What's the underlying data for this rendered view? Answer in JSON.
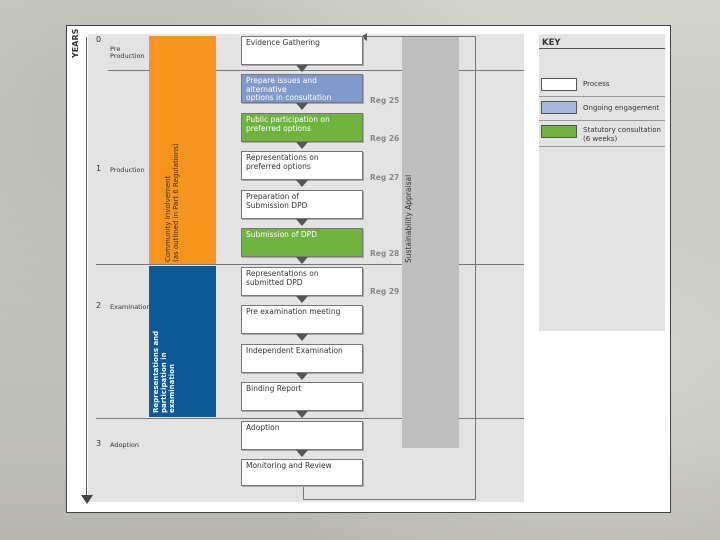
{
  "years_label": "YEARS",
  "stages": [
    {
      "number": "0",
      "label": "Pre Production",
      "label_l1": "Pre",
      "label_l2": "Production"
    },
    {
      "number": "1",
      "label": "Production"
    },
    {
      "number": "2",
      "label": "Examination"
    },
    {
      "number": "3",
      "label": "Adoption"
    }
  ],
  "side_bars": {
    "community": {
      "line1": "Community Involvement",
      "line2": "(as outlined in Part 6 Regulations)",
      "color": "#f7941d"
    },
    "representations": {
      "line1": "Representations and",
      "line2": "participation in",
      "line3": "examination",
      "color": "#0b5a97"
    },
    "sustainability": {
      "label": "Sustainability Appraisal",
      "color": "#bfbfbf"
    }
  },
  "steps": [
    {
      "lines": [
        "Evidence Gathering"
      ],
      "type": "process"
    },
    {
      "lines": [
        "Prepare issues and alternative",
        "options in consultation"
      ],
      "type": "engagement"
    },
    {
      "lines": [
        "Public participation on",
        "preferred options"
      ],
      "type": "statutory"
    },
    {
      "lines": [
        "Representations on",
        "preferred options"
      ],
      "type": "process"
    },
    {
      "lines": [
        "Preparation of",
        "Submission DPD"
      ],
      "type": "process"
    },
    {
      "lines": [
        "Submission of DPD"
      ],
      "type": "statutory"
    },
    {
      "lines": [
        "Representations on",
        "submitted DPD"
      ],
      "type": "process"
    },
    {
      "lines": [
        "Pre examination meeting"
      ],
      "type": "process"
    },
    {
      "lines": [
        "Independent Examination"
      ],
      "type": "process"
    },
    {
      "lines": [
        "Binding Report"
      ],
      "type": "process"
    },
    {
      "lines": [
        "Adoption"
      ],
      "type": "process"
    },
    {
      "lines": [
        "Monitoring and Review"
      ],
      "type": "process"
    }
  ],
  "regs": [
    "Reg 25",
    "Reg 26",
    "Reg 27",
    "Reg 28",
    "Reg 29"
  ],
  "key": {
    "title": "KEY",
    "items": [
      {
        "label": "Process",
        "color": "#ffffff"
      },
      {
        "label": "Ongoing engagement",
        "color": "#a7b9dd"
      },
      {
        "label": "Statutory consultation (6 weeks)",
        "label_l1": "Statutory consultation",
        "label_l2": "(6 weeks)",
        "color": "#6eb43f"
      }
    ]
  }
}
